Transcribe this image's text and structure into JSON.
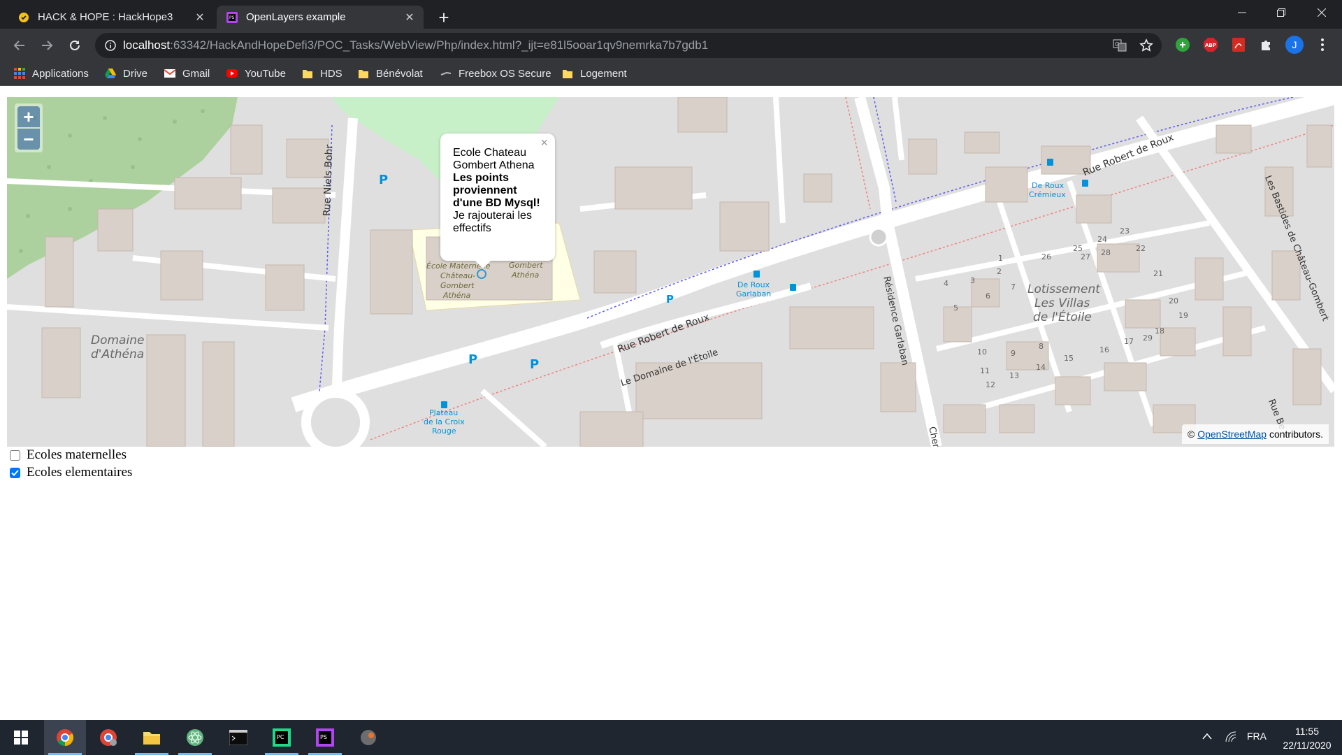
{
  "browser": {
    "tabs": [
      {
        "title": "HACK & HOPE : HackHope3",
        "icon": "hackhope-favicon-icon",
        "active": false
      },
      {
        "title": "OpenLayers example",
        "icon": "phpstorm-favicon-icon",
        "active": true
      }
    ],
    "address": {
      "host": "localhost",
      "path": ":63342/HackAndHopeDefi3/POC_Tasks/WebView/Php/index.html?_ijt=e81l5ooar1qv9nemrka7b7gdb1"
    },
    "profile_initial": "J",
    "bookmarks": [
      {
        "label": "Applications",
        "icon": "apps-grid-icon"
      },
      {
        "label": "Drive",
        "icon": "drive-icon"
      },
      {
        "label": "Gmail",
        "icon": "gmail-icon"
      },
      {
        "label": "YouTube",
        "icon": "youtube-icon"
      },
      {
        "label": "HDS",
        "icon": "folder-icon"
      },
      {
        "label": "Bénévolat",
        "icon": "folder-icon"
      },
      {
        "label": "Freebox OS Secure",
        "icon": "freebox-icon"
      },
      {
        "label": "Logement",
        "icon": "folder-icon"
      }
    ]
  },
  "map": {
    "zoom_in": "+",
    "zoom_out": "−",
    "popup": {
      "name": "Ecole Chateau Gombert Athena",
      "bold_text": "Les points proviennent d'une BD Mysql!",
      "note": "Je rajouterai les effectifs",
      "close": "×"
    },
    "attribution": {
      "prefix": "©",
      "link": "OpenStreetMap",
      "suffix": "contributors."
    },
    "labels": {
      "rue_robert_de_roux_1": "Rue Robert de Roux",
      "rue_robert_de_roux_2": "Rue Robert de Roux",
      "rue_niels_bohr": "Rue Niels Bohr",
      "le_domaine_etoile": "Le Domaine de l'Étoile",
      "residence_garlaban": "Résidence Garlaban",
      "les_bastides": "Les Bastides de Château-Gombert",
      "domaine_1": "Domaine",
      "domaine_2": "d'Athéna",
      "lotissement_1": "Lotissement",
      "lotissement_2": "Les Villas",
      "lotissement_3": "de l'Étoile",
      "ecole_1": "École Maternelle",
      "ecole_2": "Château-",
      "ecole_3": "Gombert",
      "ecole_4": "Athéna",
      "gombert_1": "Gombert",
      "gombert_2": "Athéna",
      "stop_roux_cremieux_1": "De Roux",
      "stop_roux_cremieux_2": "Crémieux",
      "stop_roux_garlaban_1": "De Roux",
      "stop_roux_garlaban_2": "Garlaban",
      "stop_plateau_1": "Plateau",
      "stop_plateau_2": "de la Croix",
      "stop_plateau_3": "Rouge",
      "chemin_partial": "Chemi",
      "rue_be_partial": "Rue Be",
      "parking": "P"
    },
    "house_numbers": [
      "23",
      "24",
      "25",
      "26",
      "27",
      "28",
      "22",
      "21",
      "20",
      "19",
      "18",
      "17",
      "16",
      "15",
      "14",
      "13",
      "12",
      "11",
      "10",
      "9",
      "8",
      "7",
      "6",
      "5",
      "4",
      "3",
      "2",
      "1",
      "29"
    ]
  },
  "layers": [
    {
      "label": "Ecoles maternelles",
      "checked": false
    },
    {
      "label": "Ecoles elementaires",
      "checked": true
    }
  ],
  "taskbar": {
    "apps": [
      "windows-start-icon",
      "chrome-icon",
      "chrome-profile-icon",
      "file-explorer-icon",
      "atom-icon",
      "terminal-icon",
      "pycharm-icon",
      "phpstorm-icon",
      "app-icon"
    ],
    "language": "FRA",
    "time": "11:55",
    "date": "22/11/2020"
  },
  "colors": {
    "chrome_dark": "#202124",
    "toolbar": "#35363a",
    "map_background": "#e0dfdf",
    "building": "#d9d0c9",
    "school_area": "#ffffe5",
    "grass": "#cdebb0",
    "forest": "#add19e",
    "checkbox_accent": "#0075ff",
    "taskbar": "#1f2630"
  }
}
